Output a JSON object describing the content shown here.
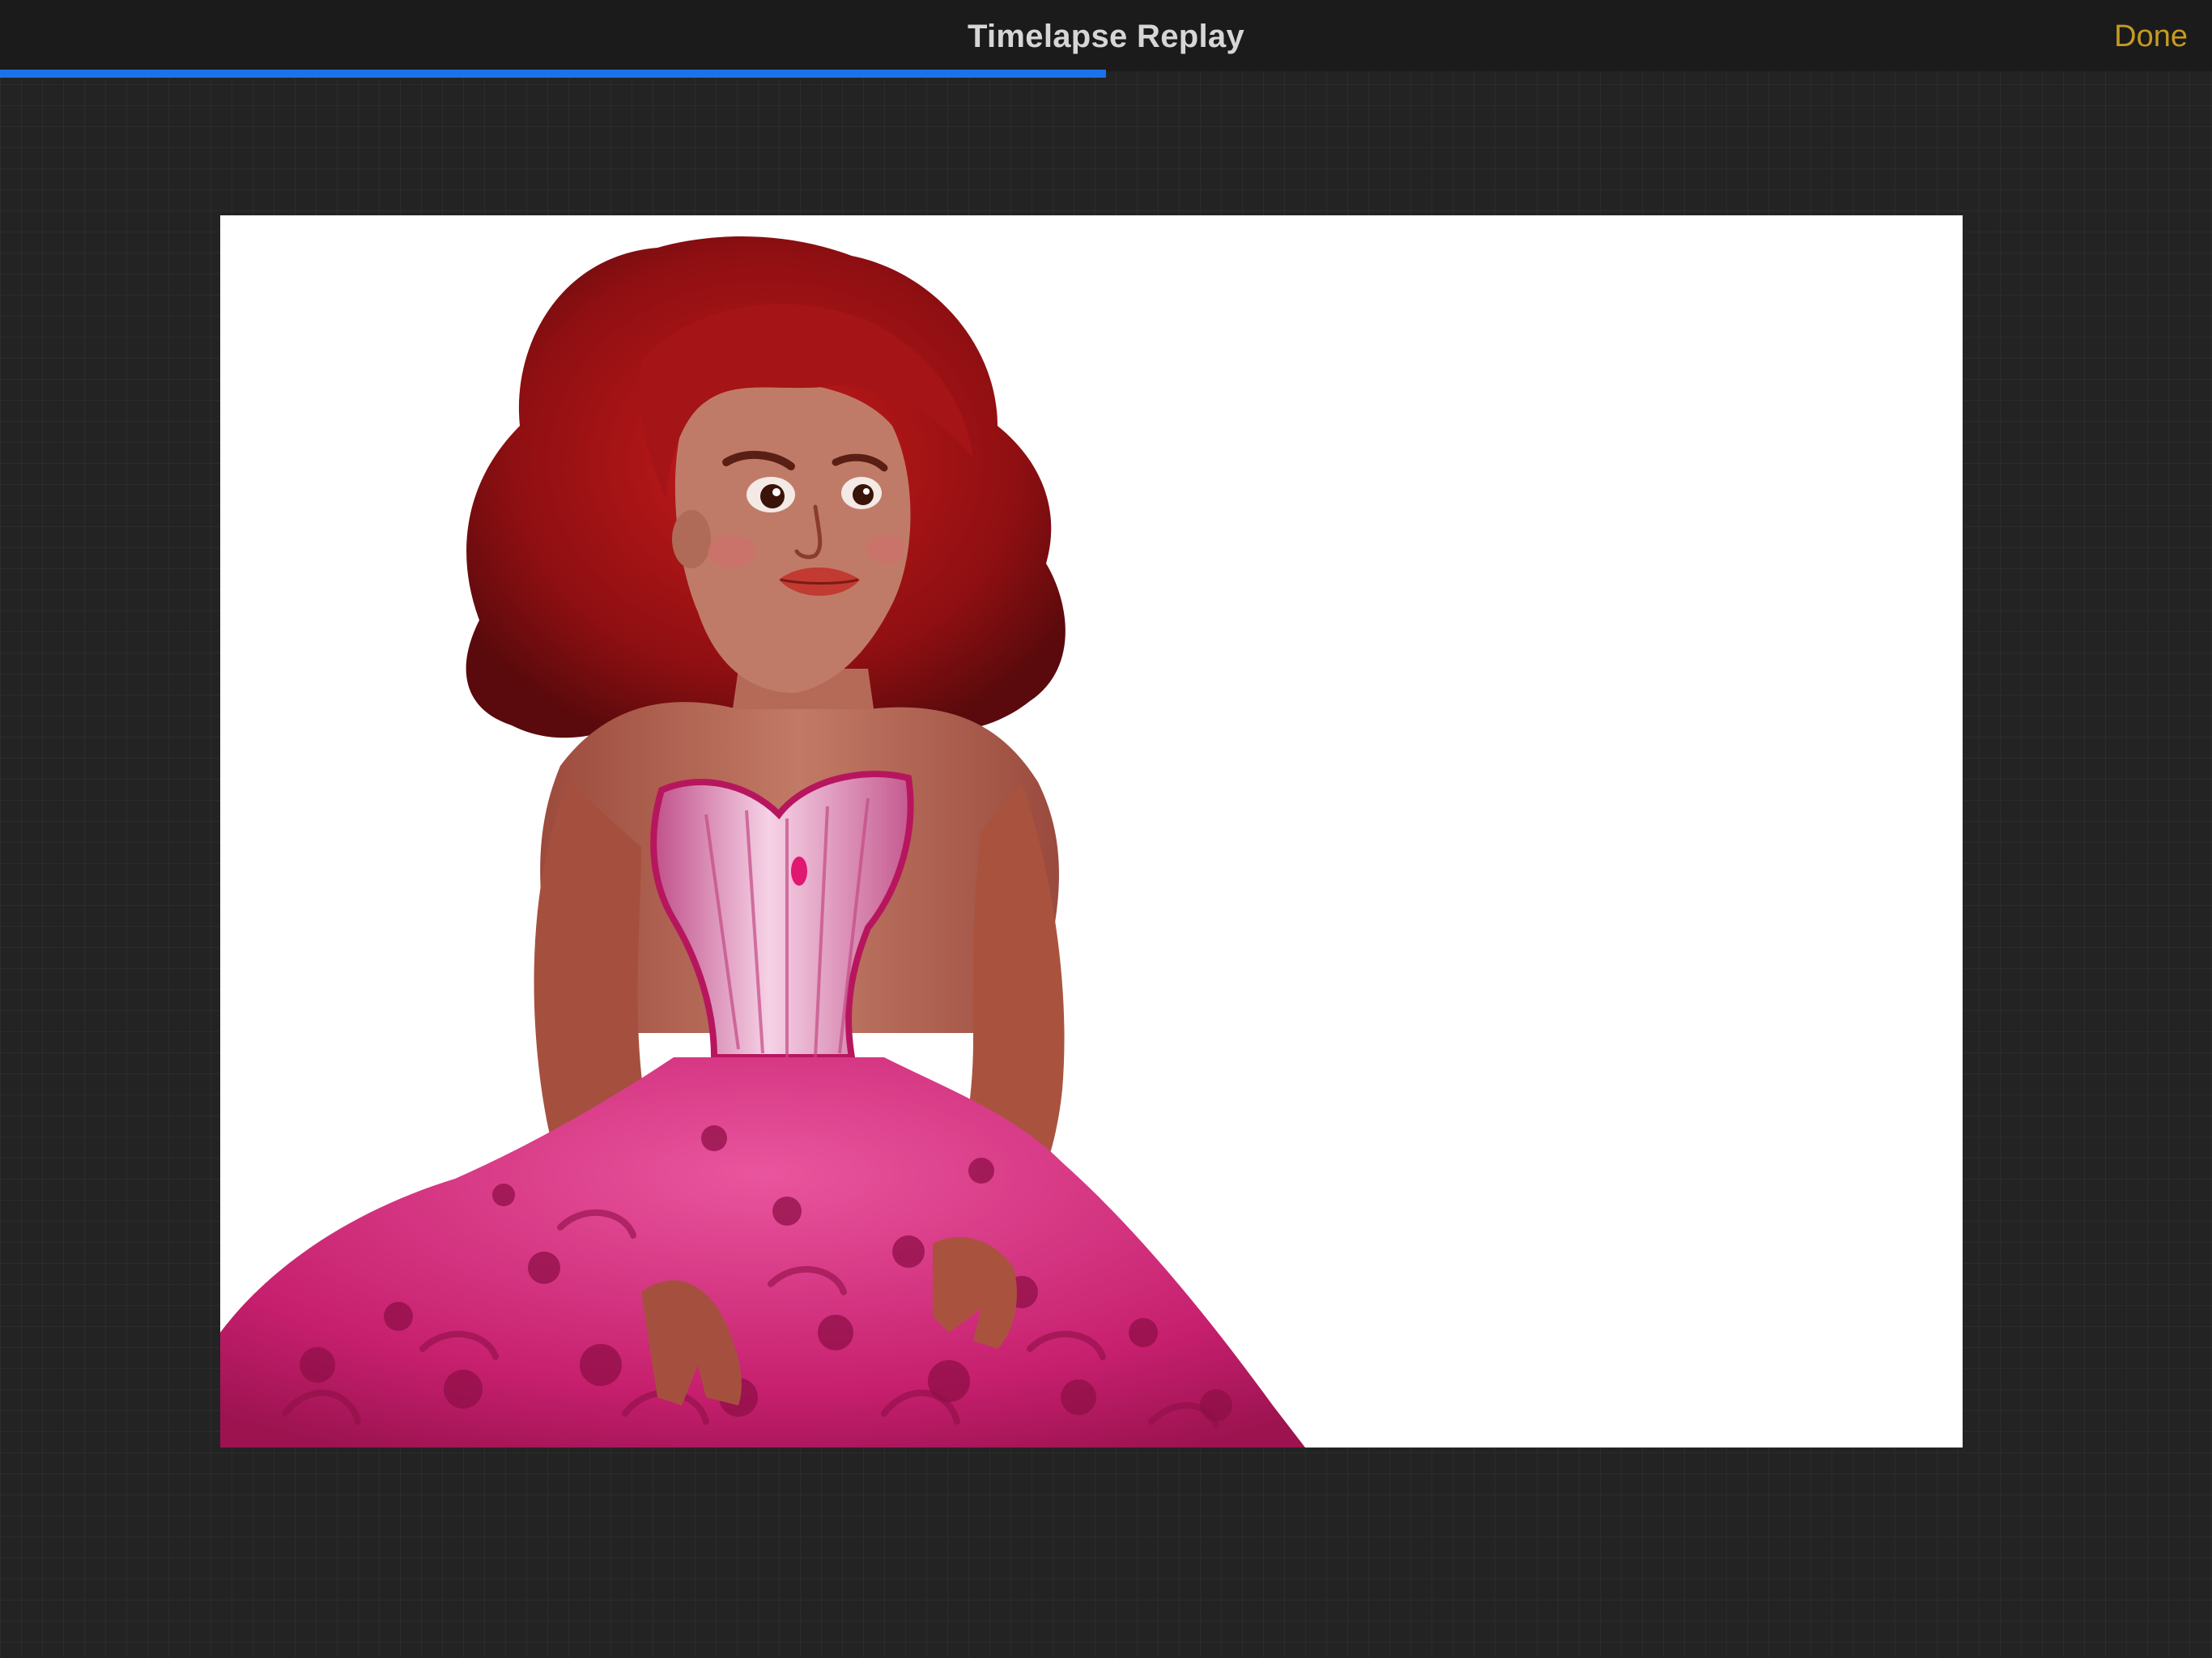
{
  "header": {
    "title": "Timelapse Replay",
    "done_label": "Done"
  },
  "playback": {
    "progress": 0.5
  },
  "artwork": {
    "subject": "illustration-of-woman-in-pink-dress"
  },
  "colors": {
    "accent_blue": "#1a73e8",
    "done_gold": "#c69a22"
  }
}
